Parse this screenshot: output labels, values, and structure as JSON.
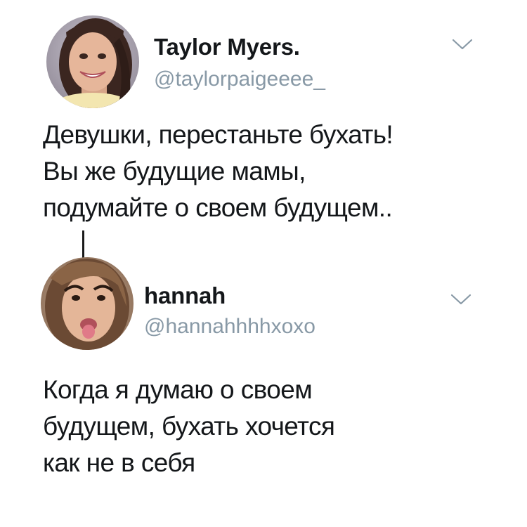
{
  "tweets": [
    {
      "display_name": "Taylor Myers.",
      "handle": "@taylorpaigeeee_",
      "avatar_icon": "avatar-photo",
      "menu_icon": "chevron-down-icon",
      "text_lines": [
        "Девушки, перестаньте бухать!",
        "Вы же будущие мамы,",
        "подумайте о своем будущем.."
      ]
    },
    {
      "display_name": "hannah",
      "handle": "@hannahhhhxoxo",
      "avatar_icon": "avatar-photo",
      "menu_icon": "chevron-down-icon",
      "text_lines": [
        "Когда я думаю о своем",
        "будущем, бухать хочется",
        "как не в себя"
      ]
    }
  ],
  "colors": {
    "text": "#14171a",
    "secondary": "#8899a6",
    "background": "#ffffff"
  }
}
